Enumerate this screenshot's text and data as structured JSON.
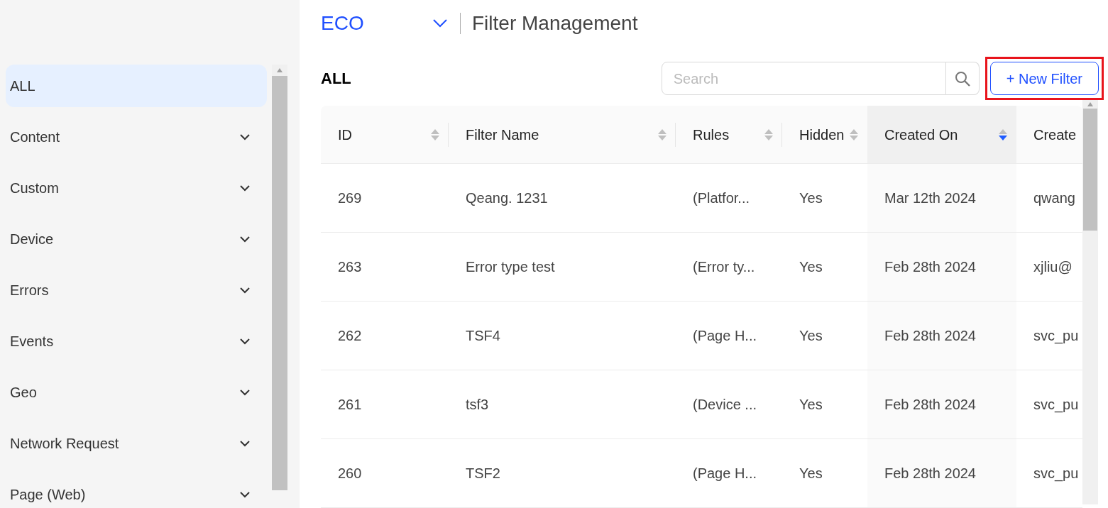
{
  "sidebar": {
    "items": [
      {
        "label": "ALL",
        "selected": true,
        "expandable": false
      },
      {
        "label": "Content",
        "selected": false,
        "expandable": true
      },
      {
        "label": "Custom",
        "selected": false,
        "expandable": true
      },
      {
        "label": "Device",
        "selected": false,
        "expandable": true
      },
      {
        "label": "Errors",
        "selected": false,
        "expandable": true
      },
      {
        "label": "Events",
        "selected": false,
        "expandable": true
      },
      {
        "label": "Geo",
        "selected": false,
        "expandable": true
      },
      {
        "label": "Network Request",
        "selected": false,
        "expandable": true
      },
      {
        "label": "Page (Web)",
        "selected": false,
        "expandable": true
      }
    ]
  },
  "header": {
    "app": "ECO",
    "title": "Filter Management"
  },
  "toolbar": {
    "heading": "ALL",
    "search": {
      "placeholder": "Search"
    },
    "new_button": {
      "label": "+ New Filter",
      "highlighted": true
    }
  },
  "table": {
    "columns": [
      {
        "label": "ID",
        "sortable": true,
        "sorted": false
      },
      {
        "label": "Filter Name",
        "sortable": true,
        "sorted": false
      },
      {
        "label": "Rules",
        "sortable": true,
        "sorted": false
      },
      {
        "label": "Hidden",
        "sortable": true,
        "sorted": false
      },
      {
        "label": "Created On",
        "sortable": true,
        "sorted": true
      },
      {
        "label": "Create"
      }
    ],
    "rows": [
      [
        "269",
        "Qeang. 1231",
        "(Platfor...",
        "Yes",
        "Mar 12th 2024",
        "qwang"
      ],
      [
        "263",
        "Error type test",
        "(Error ty...",
        "Yes",
        "Feb 28th 2024",
        "xjliu@"
      ],
      [
        "262",
        "TSF4",
        "(Page H...",
        "Yes",
        "Feb 28th 2024",
        "svc_pu"
      ],
      [
        "261",
        "tsf3",
        "(Device ...",
        "Yes",
        "Feb 28th 2024",
        "svc_pu"
      ],
      [
        "260",
        "TSF2",
        "(Page H...",
        "Yes",
        "Feb 28th 2024",
        "svc_pu"
      ]
    ]
  }
}
